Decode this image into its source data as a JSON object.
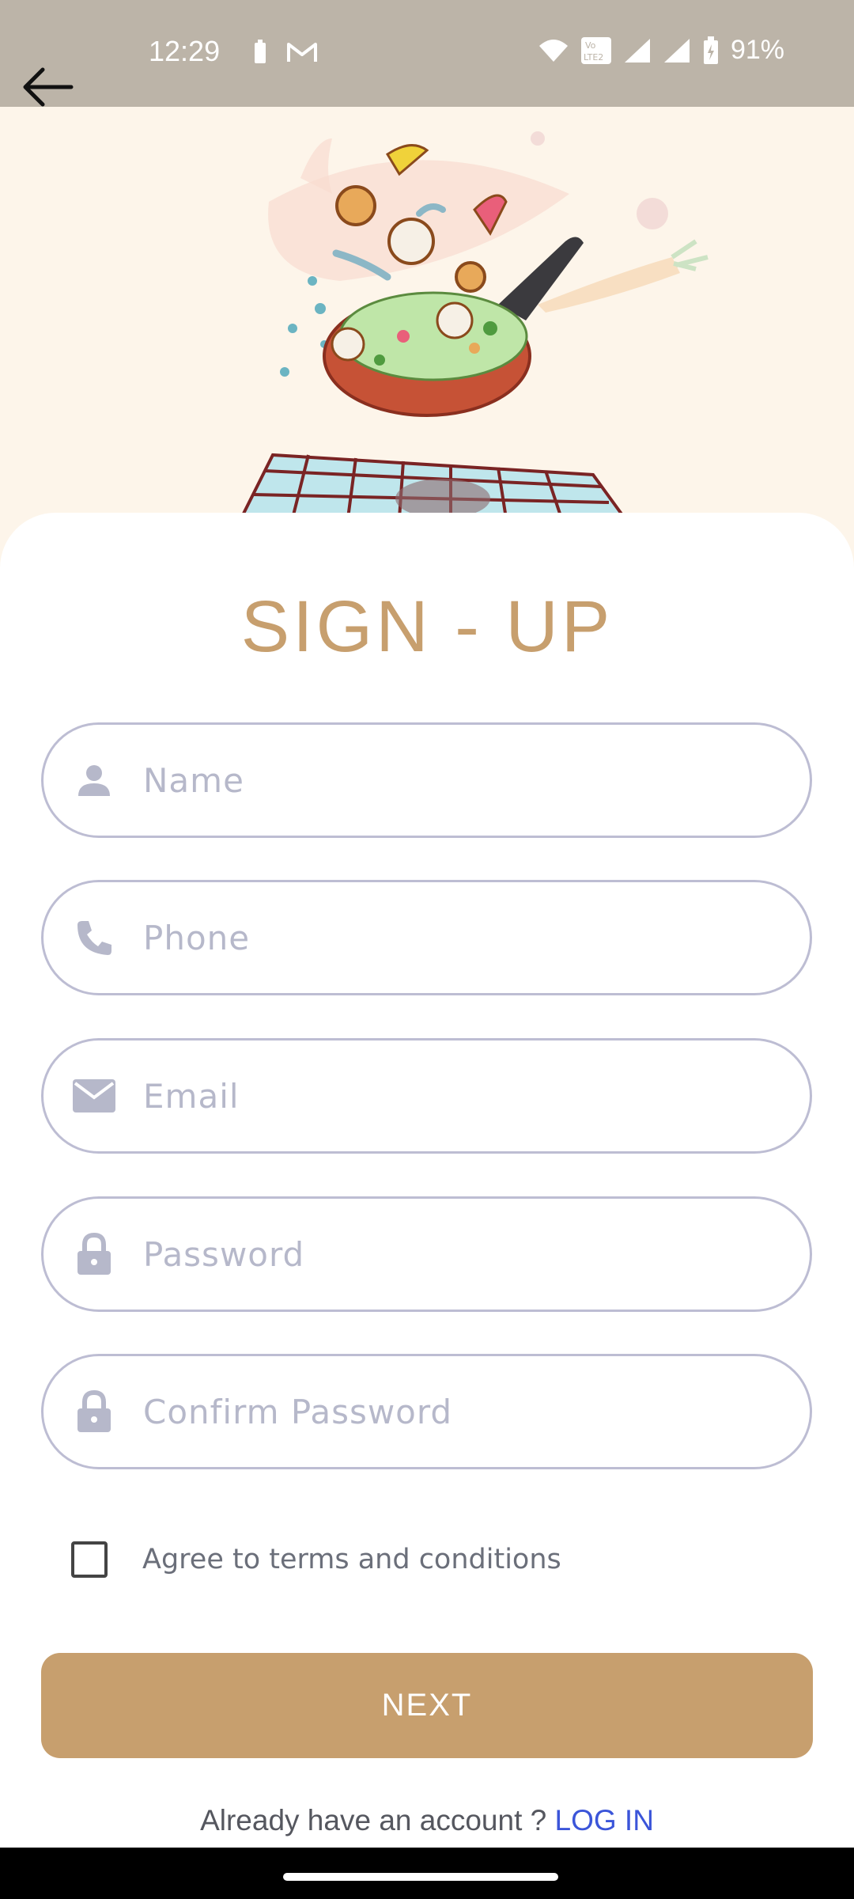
{
  "status_bar": {
    "time": "12:29",
    "battery": "91%",
    "icons": [
      "battery-small-icon",
      "gmail-icon",
      "wifi-icon",
      "volte-icon",
      "signal-icon",
      "signal-icon",
      "battery-charging-icon"
    ]
  },
  "title": "SIGN - UP",
  "form": {
    "name_placeholder": "Name",
    "phone_placeholder": "Phone",
    "email_placeholder": "Email",
    "password_placeholder": "Password",
    "confirm_password_placeholder": "Confirm Password",
    "terms_label": "Agree to terms and conditions",
    "terms_checked": false
  },
  "next_label": "NEXT",
  "login": {
    "prompt": "Already have an account ? ",
    "link_label": "LOG IN"
  },
  "colors": {
    "accent": "#c79f6e",
    "link": "#3b55d9",
    "status_bar": "#bcb4a8",
    "field_border": "#bdbdd3",
    "icon_gray": "#b6b8ca"
  }
}
